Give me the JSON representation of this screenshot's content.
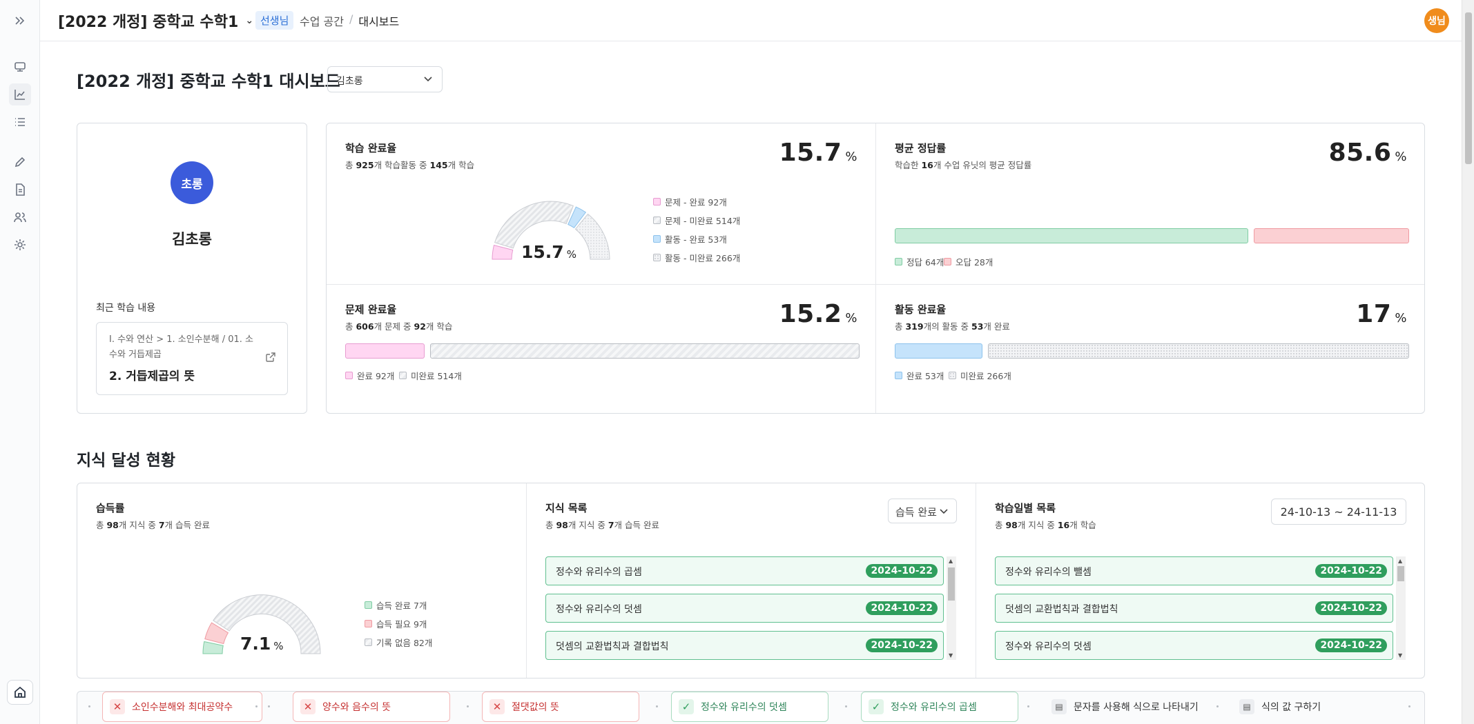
{
  "header": {
    "course_title": "[2022 개정] 중학교 수학1",
    "role_badge": "선생님",
    "crumb_1": "수업 공간",
    "crumb_sep": "/",
    "crumb_2": "대시보드",
    "avatar_label": "생님"
  },
  "page": {
    "title": "[2022 개정] 중학교 수학1 대시보드",
    "student_select_value": "김초롱"
  },
  "profile": {
    "avatar_label": "초롱",
    "name": "김초롱",
    "recent_label": "최근 학습 내용",
    "recent_path": "I. 수와 연산 > 1. 소인수분해 / 01. 소수와 거듭제곱",
    "recent_title": "2. 거듭제곱의 뜻"
  },
  "learning_completion": {
    "title": "학습 완료율",
    "subtitle_prefix": "총 ",
    "total": "925",
    "subtitle_mid": "개 학습활동 중 ",
    "done": "145",
    "subtitle_suffix": "개 학습",
    "value": "15.7",
    "unit": "%",
    "gauge_label": "15.7",
    "legend": [
      "문제 - 완료 92개",
      "문제 - 미완료 514개",
      "활동 - 완료 53개",
      "활동 - 미완료 266개"
    ]
  },
  "avg_correct": {
    "title": "평균 정답률",
    "subtitle_prefix": "학습한 ",
    "units": "16",
    "subtitle_suffix": "개 수업 유닛의 평균 정답률",
    "value": "85.6",
    "unit": "%",
    "legend": [
      "정답 64개",
      "오답 28개"
    ]
  },
  "problem_completion": {
    "title": "문제 완료율",
    "subtitle_prefix": "총 ",
    "total": "606",
    "subtitle_mid": "개 문제 중 ",
    "done": "92",
    "subtitle_suffix": "개 학습",
    "value": "15.2",
    "unit": "%",
    "legend": [
      "완료 92개",
      "미완료 514개"
    ]
  },
  "activity_completion": {
    "title": "활동 완료율",
    "subtitle_prefix": "총 ",
    "total": "319",
    "subtitle_mid": "개의 활동 중 ",
    "done": "53",
    "subtitle_suffix": "개 완료",
    "value": "17",
    "unit": "%",
    "legend": [
      "완료 53개",
      "미완료 266개"
    ]
  },
  "knowledge_section": {
    "title": "지식 달성 현황",
    "acquisition": {
      "title": "습득률",
      "subtitle_prefix": "총 ",
      "total": "98",
      "subtitle_mid": "개 지식 중 ",
      "done": "7",
      "subtitle_suffix": "개 습득 완료",
      "gauge_label": "7.1",
      "unit": "%",
      "legend": [
        "습득 완료 7개",
        "습득 필요 9개",
        "기록 없음 82개"
      ]
    },
    "knowledge_list": {
      "title": "지식 목록",
      "subtitle_prefix": "총 ",
      "total": "98",
      "subtitle_mid": "개 지식 중 ",
      "done": "7",
      "subtitle_suffix": "개 습득 완료",
      "filter": "습득 완료",
      "items": [
        {
          "label": "정수와 유리수의 곱셈",
          "date": "2024-10-22"
        },
        {
          "label": "정수와 유리수의 덧셈",
          "date": "2024-10-22"
        },
        {
          "label": "덧셈의 교환법칙과 결합법칙",
          "date": "2024-10-22"
        }
      ]
    },
    "daily_list": {
      "title": "학습일별 목록",
      "subtitle_prefix": "총 ",
      "total": "98",
      "subtitle_mid": "개 지식 중 ",
      "done": "16",
      "subtitle_suffix": "개 학습",
      "date_range": "24-10-13 ~ 24-11-13",
      "items": [
        {
          "label": "정수와 유리수의 뺄셈",
          "date": "2024-10-22"
        },
        {
          "label": "덧셈의 교환법칙과 결합법칙",
          "date": "2024-10-22"
        },
        {
          "label": "정수와 유리수의 덧셈",
          "date": "2024-10-22"
        }
      ]
    }
  },
  "path_strip": {
    "chips": [
      {
        "label": "소인수분해와 최대공약수",
        "status": "bad",
        "icon": "x-icon"
      },
      {
        "label": "양수와 음수의 뜻",
        "status": "bad",
        "icon": "x-icon"
      },
      {
        "label": "절댓값의 뜻",
        "status": "bad",
        "icon": "x-icon"
      },
      {
        "label": "정수와 유리수의 덧셈",
        "status": "good",
        "icon": "check-icon"
      },
      {
        "label": "정수와 유리수의 곱셈",
        "status": "good",
        "icon": "check-icon"
      },
      {
        "label": "문자를 사용해 식으로 나타내기",
        "status": "none",
        "icon": "document-icon"
      },
      {
        "label": "식의 값 구하기",
        "status": "none",
        "icon": "document-icon"
      }
    ]
  },
  "colors": {
    "primary_avatar": "#3b5bdb",
    "teacher_avatar": "#f08c1c",
    "done_problem": "#ffd6f2",
    "done_activity": "#c5e3fb",
    "correct": "#c8ecd9",
    "wrong": "#fbd0d3",
    "date_badge": "#2f9e5d"
  }
}
